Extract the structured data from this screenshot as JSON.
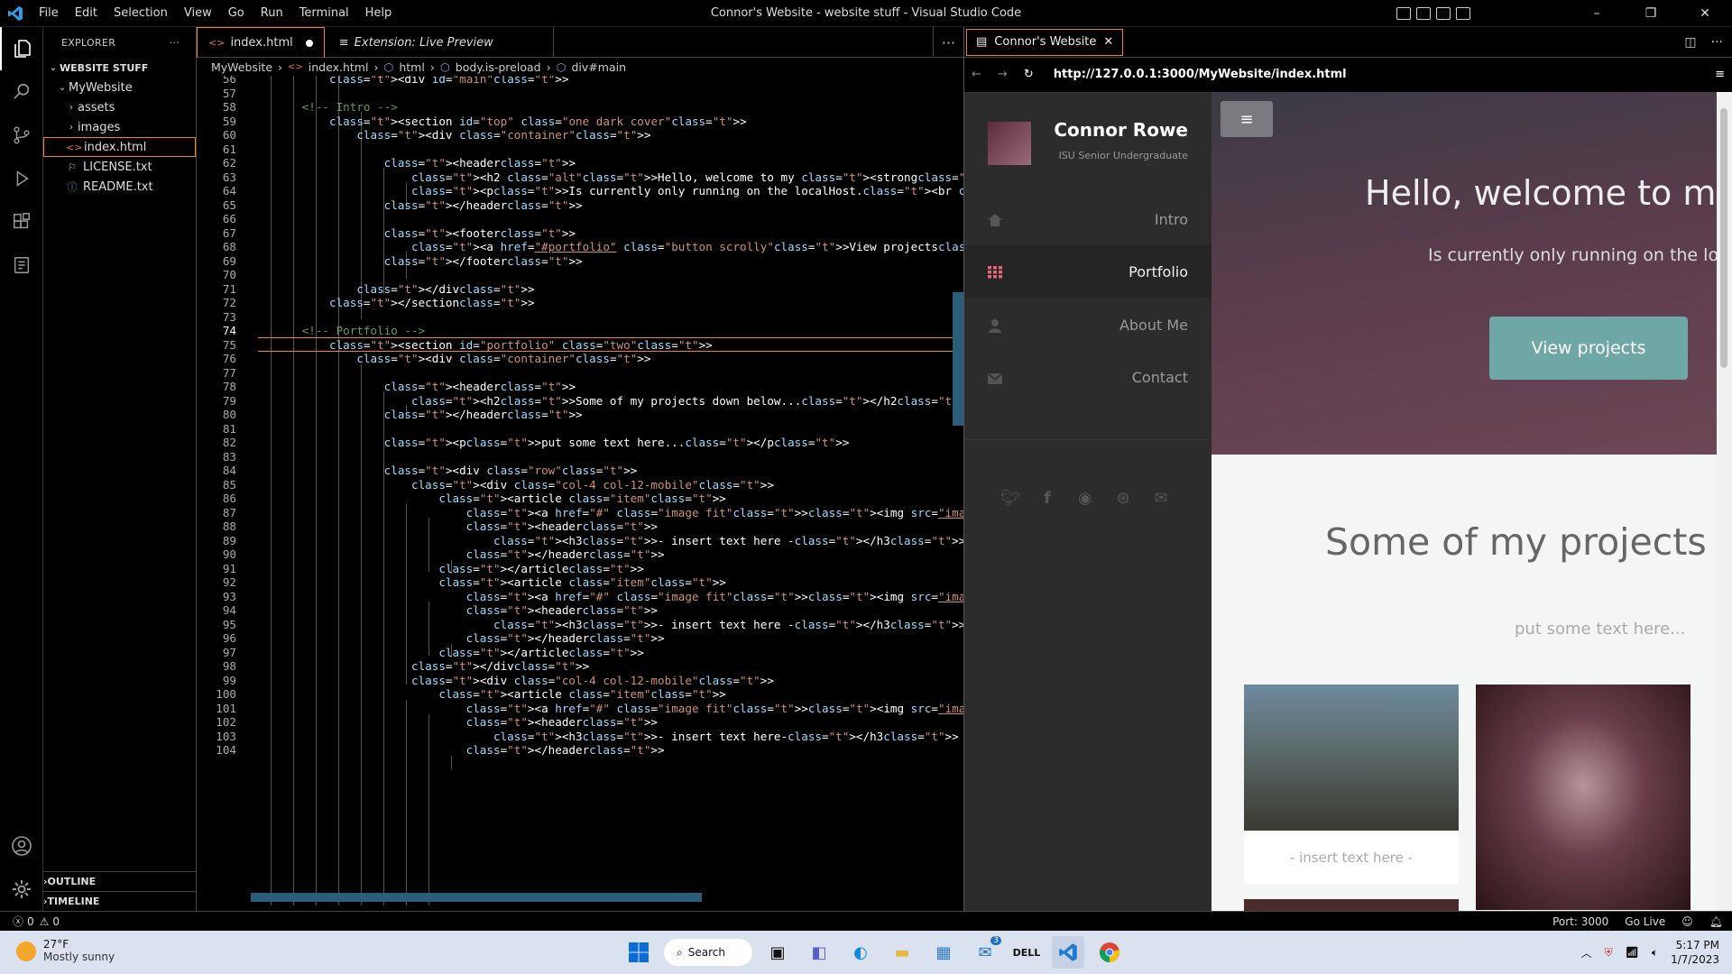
{
  "window": {
    "title": "Connor's Website - website stuff - Visual Studio Code",
    "menu": [
      "File",
      "Edit",
      "Selection",
      "View",
      "Go",
      "Run",
      "Terminal",
      "Help"
    ]
  },
  "explorer": {
    "title": "EXPLORER",
    "root": "WEBSITE STUFF",
    "folder": "MyWebsite",
    "items": [
      {
        "label": "assets",
        "type": "folder"
      },
      {
        "label": "images",
        "type": "folder"
      },
      {
        "label": "index.html",
        "type": "html"
      },
      {
        "label": "LICENSE.txt",
        "type": "license"
      },
      {
        "label": "README.txt",
        "type": "info"
      }
    ],
    "outline": "OUTLINE",
    "timeline": "TIMELINE"
  },
  "editor": {
    "tabs": [
      {
        "label": "index.html",
        "modified": true
      },
      {
        "label": "Extension: Live Preview",
        "modified": false
      }
    ],
    "breadcrumbs": [
      "MyWebsite",
      "index.html",
      "html",
      "body.is-preload",
      "div#main"
    ],
    "current_line": 74
  },
  "preview": {
    "tab_title": "Connor's Website",
    "url": "http://127.0.0.1:3000/MyWebsite/index.html",
    "site": {
      "name": "Connor Rowe",
      "subtitle": "ISU Senior Undergraduate",
      "nav": [
        "Intro",
        "Portfolio",
        "About Me",
        "Contact"
      ],
      "active_nav": "Portfolio",
      "hero_title": "Hello, welcome to my w",
      "hero_text": "Is currently only running on the localH",
      "hero_button": "View projects",
      "section_title": "Some of my projects dowr",
      "section_text": "put some text here...",
      "card_caption": "- insert text here -"
    }
  },
  "status": {
    "errors": "0",
    "warnings": "0",
    "port": "Port: 3000",
    "golive": "Go Live"
  },
  "taskbar": {
    "temp": "27°F",
    "weather": "Mostly sunny",
    "search": "Search",
    "mail_badge": "3",
    "time": "5:17 PM",
    "date": "1/7/2023"
  },
  "colors": {
    "accent": "#f38518",
    "tag": "#3794ff",
    "attr": "#9cdcfe",
    "string": "#ce9178",
    "comment": "#6a9955"
  }
}
